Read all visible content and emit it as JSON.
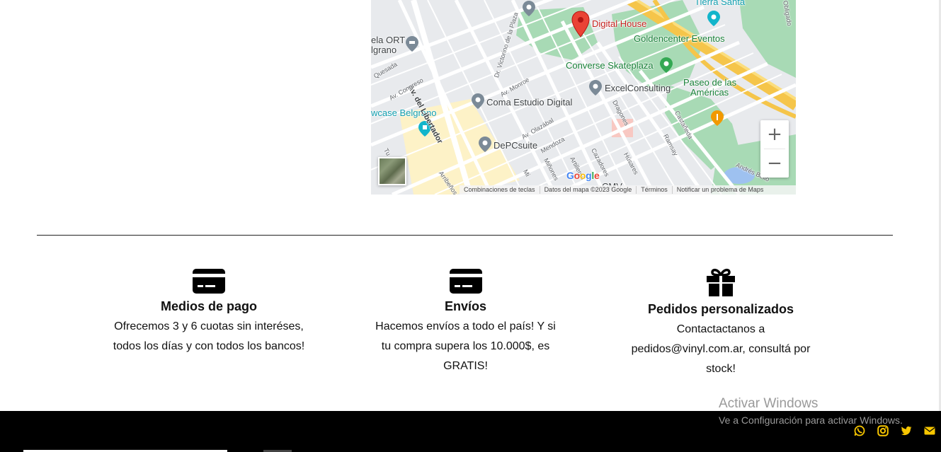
{
  "map": {
    "marker_label": "Digital House",
    "places": {
      "goldencenter": "Goldencenter Eventos",
      "converse": "Converse Skateplaza",
      "excel": "ExcelConsulting",
      "paseo_line1": "Paseo de las",
      "paseo_line2": "Américas",
      "coma": "Coma Estudio Digital",
      "depc": "DePCsuite",
      "showcase": "wcase Belgrano",
      "ort_line1": "ela ORT",
      "ort_line2": "lgrano",
      "tierra_santa": "Tierra Santa",
      "cmv": "CMV"
    },
    "streets": {
      "libertador": "Av. del Libertador",
      "victorino": "Dr. Victorino de la Plaza",
      "monroe": "Av. Monroe",
      "congreso": "Av. Congreso",
      "quesada": "Quesada",
      "olazabal": "Av. Olazábal",
      "mendoza": "Mendoza",
      "dragones": "Dragones",
      "castaneda": "Castañeda",
      "ramsay": "Ramsay",
      "husares": "Húsares",
      "cazadores": "Cazadores",
      "artilleros": "Artilleros",
      "miñones": "Miñones",
      "arribenos": "Arribeños",
      "obligado": "Obligado",
      "andres_bello": "Andrés Bello",
      "tu": "Tu",
      "mi": "Mi"
    },
    "zoom_in": "+",
    "zoom_out": "−",
    "google_logo": "Google",
    "footer": {
      "shortcuts": "Combinaciones de teclas",
      "data": "Datos del mapa ©2023 Google",
      "terms": "Términos",
      "report": "Notificar un problema de Maps"
    }
  },
  "features": [
    {
      "icon": "credit-card-icon",
      "title": "Medios de pago",
      "text": "Ofrecemos 3 y 6 cuotas sin interéses, todos los días y con todos los bancos!"
    },
    {
      "icon": "credit-card-icon",
      "title": "Envíos",
      "text": "Hacemos envíos a todo el país! Y si tu compra supera los 10.000$, es GRATIS!"
    },
    {
      "icon": "gift-icon",
      "title": "Pedidos personalizados",
      "text": "Contactactanos a pedidos@vinyl.com.ar, consultá por stock!"
    }
  ],
  "watermark": {
    "title": "Activar Windows",
    "subtitle": "Ve a Configuración para activar Windows."
  },
  "footer": {
    "social": [
      "whatsapp-icon",
      "instagram-icon",
      "twitter-icon",
      "email-icon"
    ],
    "accent_color": "#f7c600"
  }
}
